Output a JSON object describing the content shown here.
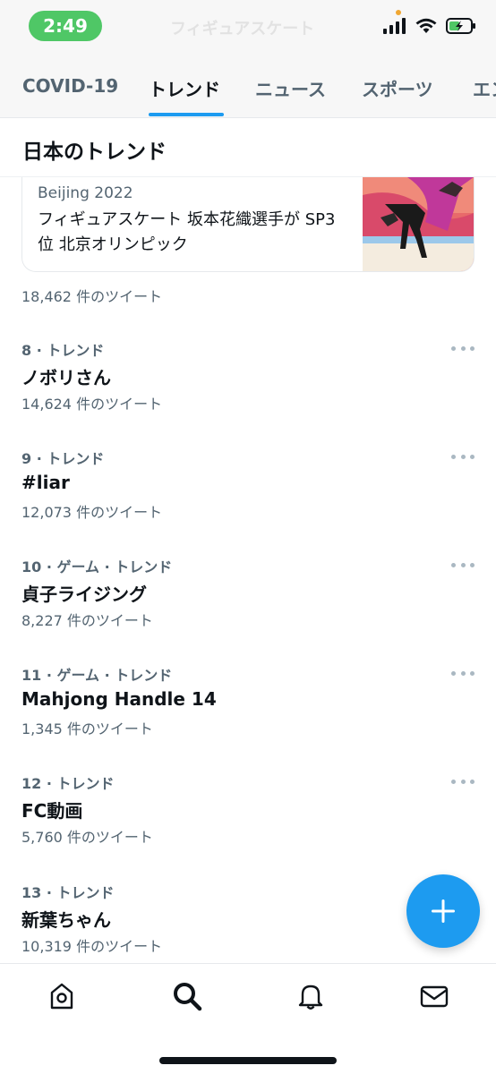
{
  "status_bar": {
    "time": "2:49",
    "ghost_title": "フィギュアスケート"
  },
  "tabs": [
    {
      "label": "COVID-19",
      "active": false
    },
    {
      "label": "トレンド",
      "active": true
    },
    {
      "label": "ニュース",
      "active": false
    },
    {
      "label": "スポーツ",
      "active": false
    },
    {
      "label": "エン",
      "active": false
    }
  ],
  "section": {
    "title": "日本のトレンド"
  },
  "news_card": {
    "category": "Beijing 2022",
    "headline": "フィギュアスケート 坂本花織選手が SP3位 北京オリンピック",
    "tweet_count": "18,462 件のツイート"
  },
  "trends": [
    {
      "meta": "8 · トレンド",
      "name": "ノボリさん",
      "count": "14,624 件のツイート"
    },
    {
      "meta": "9 · トレンド",
      "name": "#liar",
      "count": "12,073 件のツイート"
    },
    {
      "meta": "10 · ゲーム · トレンド",
      "name": "貞子ライジング",
      "count": "8,227 件のツイート"
    },
    {
      "meta": "11 · ゲーム · トレンド",
      "name": "Mahjong Handle 14",
      "count": "1,345 件のツイート"
    },
    {
      "meta": "12 · トレンド",
      "name": "FC動画",
      "count": "5,760 件のツイート"
    },
    {
      "meta": "13 · トレンド",
      "name": "新葉ちゃん",
      "count": "10,319 件のツイート"
    }
  ],
  "bottom_nav": [
    {
      "icon": "home-icon",
      "active": false
    },
    {
      "icon": "search-icon",
      "active": true
    },
    {
      "icon": "bell-icon",
      "active": false
    },
    {
      "icon": "mail-icon",
      "active": false
    }
  ],
  "colors": {
    "accent": "#1d9bf0",
    "time_pill": "#4fc766",
    "secondary_text": "#536471"
  }
}
